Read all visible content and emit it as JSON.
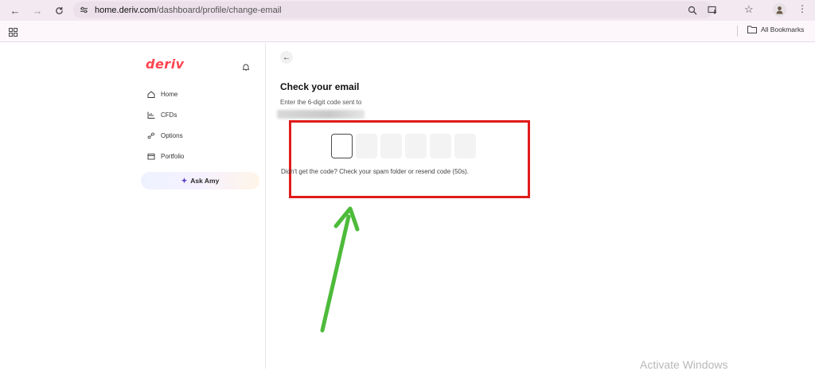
{
  "browser": {
    "url_host": "home.deriv.com",
    "url_path": "/dashboard/profile/change-email",
    "bookmarks_label": "All Bookmarks"
  },
  "sidebar": {
    "logo": "deriv",
    "items": [
      {
        "label": "Home",
        "icon": "home-icon"
      },
      {
        "label": "CFDs",
        "icon": "chart-icon"
      },
      {
        "label": "Options",
        "icon": "options-icon"
      },
      {
        "label": "Portfolio",
        "icon": "portfolio-icon"
      }
    ],
    "ask_amy_label": "Ask Amy"
  },
  "main": {
    "title": "Check your email",
    "subtitle": "Enter the 6-digit code sent to",
    "otp_count": 6,
    "resend_text": "Didn't get the code? Check your spam folder or resend code (50s)."
  },
  "overlay": {
    "watermark": "Activate Windows",
    "highlight_color": "#e01b1b",
    "arrow_color": "#4dbb3a"
  },
  "colors": {
    "brand": "#ff444f"
  }
}
